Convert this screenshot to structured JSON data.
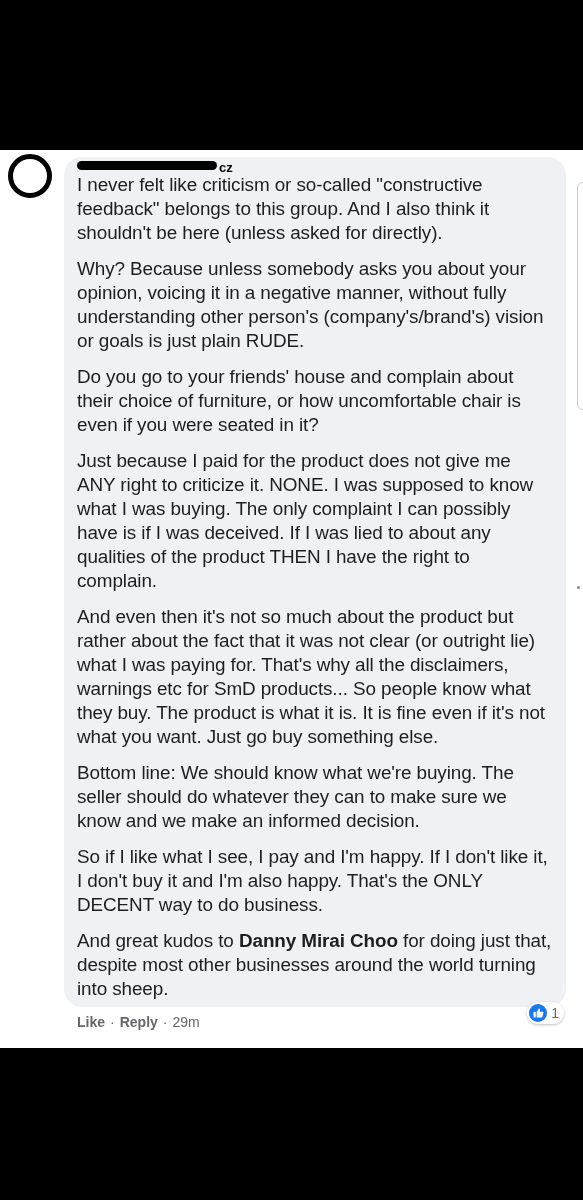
{
  "comment": {
    "author_visible": "cz",
    "paragraphs": [
      "I never felt like criticism or so-called \"constructive feedback\" belongs to this group. And I also think it shouldn't be here (unless asked for directly).",
      "Why? Because unless somebody asks you about your opinion, voicing it in a negative manner, without fully understanding other person's (company's/brand's) vision or goals is just plain RUDE.",
      "Do you go to your friends' house and complain about their choice of furniture, or how uncomfortable chair is even if you were seated in it?",
      "Just because I paid for the product does not give me ANY right to criticize it. NONE. I was supposed to know what I was buying. The only complaint I can possibly have is if I was deceived. If I was lied to about any qualities of the product THEN I have the right to complain.",
      "And even then it's not so much about the product but rather about the fact that it was not clear (or outright lie) what I was paying for. That's why all the disclaimers, warnings etc for SmD products... So people know what they buy. The product is what it is. It is fine even if it's not what you want. Just go buy something else.",
      "Bottom line: We should know what we're buying. The seller should do whatever they can to make sure we know and we make an informed decision.",
      "So if I like what I see, I pay and I'm happy. If I don't like it, I don't buy it and I'm also happy. That's the ONLY DECENT way to do business.",
      "And great kudos to **Danny Mirai Choo** for doing just that, despite most other businesses around the world turning into sheep."
    ],
    "actions": [
      "Like",
      "Reply"
    ],
    "separator": "·",
    "time": "29m",
    "reaction_count": "1"
  }
}
